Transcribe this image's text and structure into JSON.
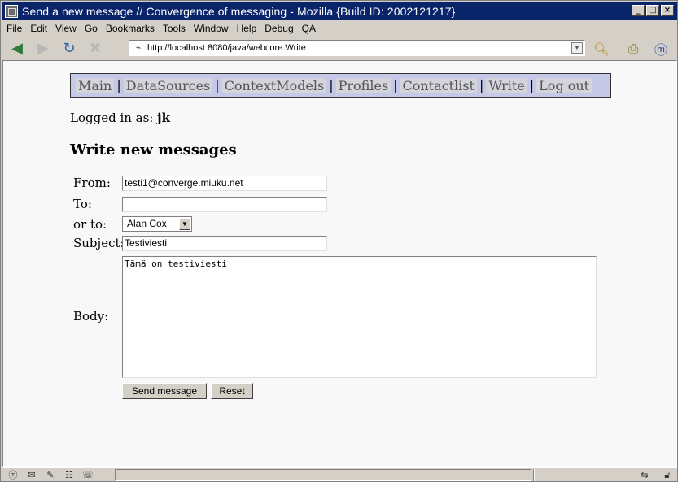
{
  "window": {
    "title": "Send a new message // Convergence of messaging - Mozilla {Build ID: 2002121217}"
  },
  "menu": [
    "File",
    "Edit",
    "View",
    "Go",
    "Bookmarks",
    "Tools",
    "Window",
    "Help",
    "Debug",
    "QA"
  ],
  "toolbar": {
    "url": "http://localhost:8080/java/webcore.Write"
  },
  "nav": {
    "items": [
      "Main",
      "DataSources",
      "ContextModels",
      "Profiles",
      "Contactlist",
      "Write",
      "Log out"
    ],
    "separator": "|"
  },
  "logged_in": {
    "label": "Logged in as:",
    "user": "jk"
  },
  "page": {
    "heading": "Write new messages"
  },
  "form": {
    "from_label": "From:",
    "from_value": "testi1@converge.miuku.net",
    "to_label": "To:",
    "to_value": "",
    "or_to_label": "or to:",
    "or_to_selected": "Alan Cox",
    "subject_label": "Subject:",
    "subject_value": "Testiviesti",
    "body_label": "Body:",
    "body_value": "Tämä on testiviesti",
    "send_label": "Send message",
    "reset_label": "Reset"
  }
}
